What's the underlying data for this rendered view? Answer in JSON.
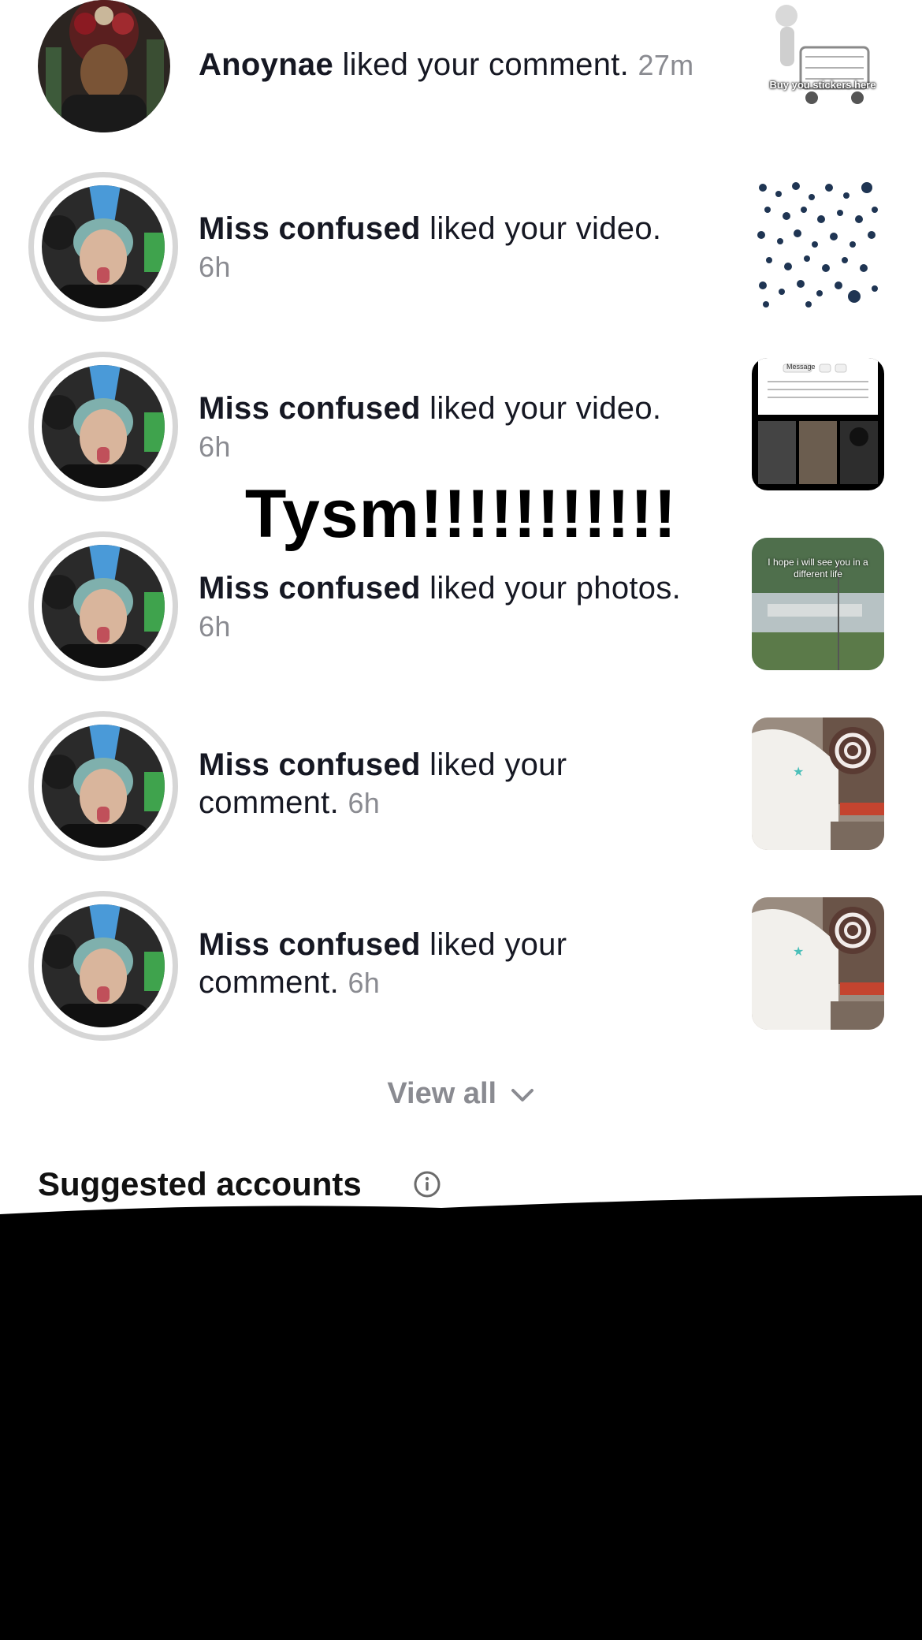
{
  "notifications": [
    {
      "user": "Anoynae",
      "action": "liked your comment.",
      "time": "27m",
      "avatar_ring": false,
      "thumb_text": "Buy you stickers here"
    },
    {
      "user": "Miss confused",
      "action": "liked your video.",
      "time": "6h",
      "avatar_ring": true,
      "thumb_text": ""
    },
    {
      "user": "Miss confused",
      "action": "liked your video.",
      "time": "6h",
      "avatar_ring": true,
      "thumb_text": "Message"
    },
    {
      "user": "Miss confused",
      "action": "liked your photos.",
      "time": "6h",
      "avatar_ring": true,
      "thumb_text": "I hope i will see you in a different life"
    },
    {
      "user": "Miss confused",
      "action": "liked your",
      "action_line2": "comment.",
      "time": "6h",
      "avatar_ring": true,
      "thumb_text": ""
    },
    {
      "user": "Miss confused",
      "action": "liked your",
      "action_line2": "comment.",
      "time": "6h",
      "avatar_ring": true,
      "thumb_text": ""
    }
  ],
  "overlay_text": "Tysm!!!!!!!!!!!",
  "view_all": {
    "label": "View all"
  },
  "suggested": {
    "title": "Suggested accounts"
  },
  "colors": {
    "time": "#8a8b91",
    "ring": "#d6d6d6",
    "redaction": "#000000"
  },
  "icons": [
    "chevron-down-icon",
    "info-icon"
  ]
}
